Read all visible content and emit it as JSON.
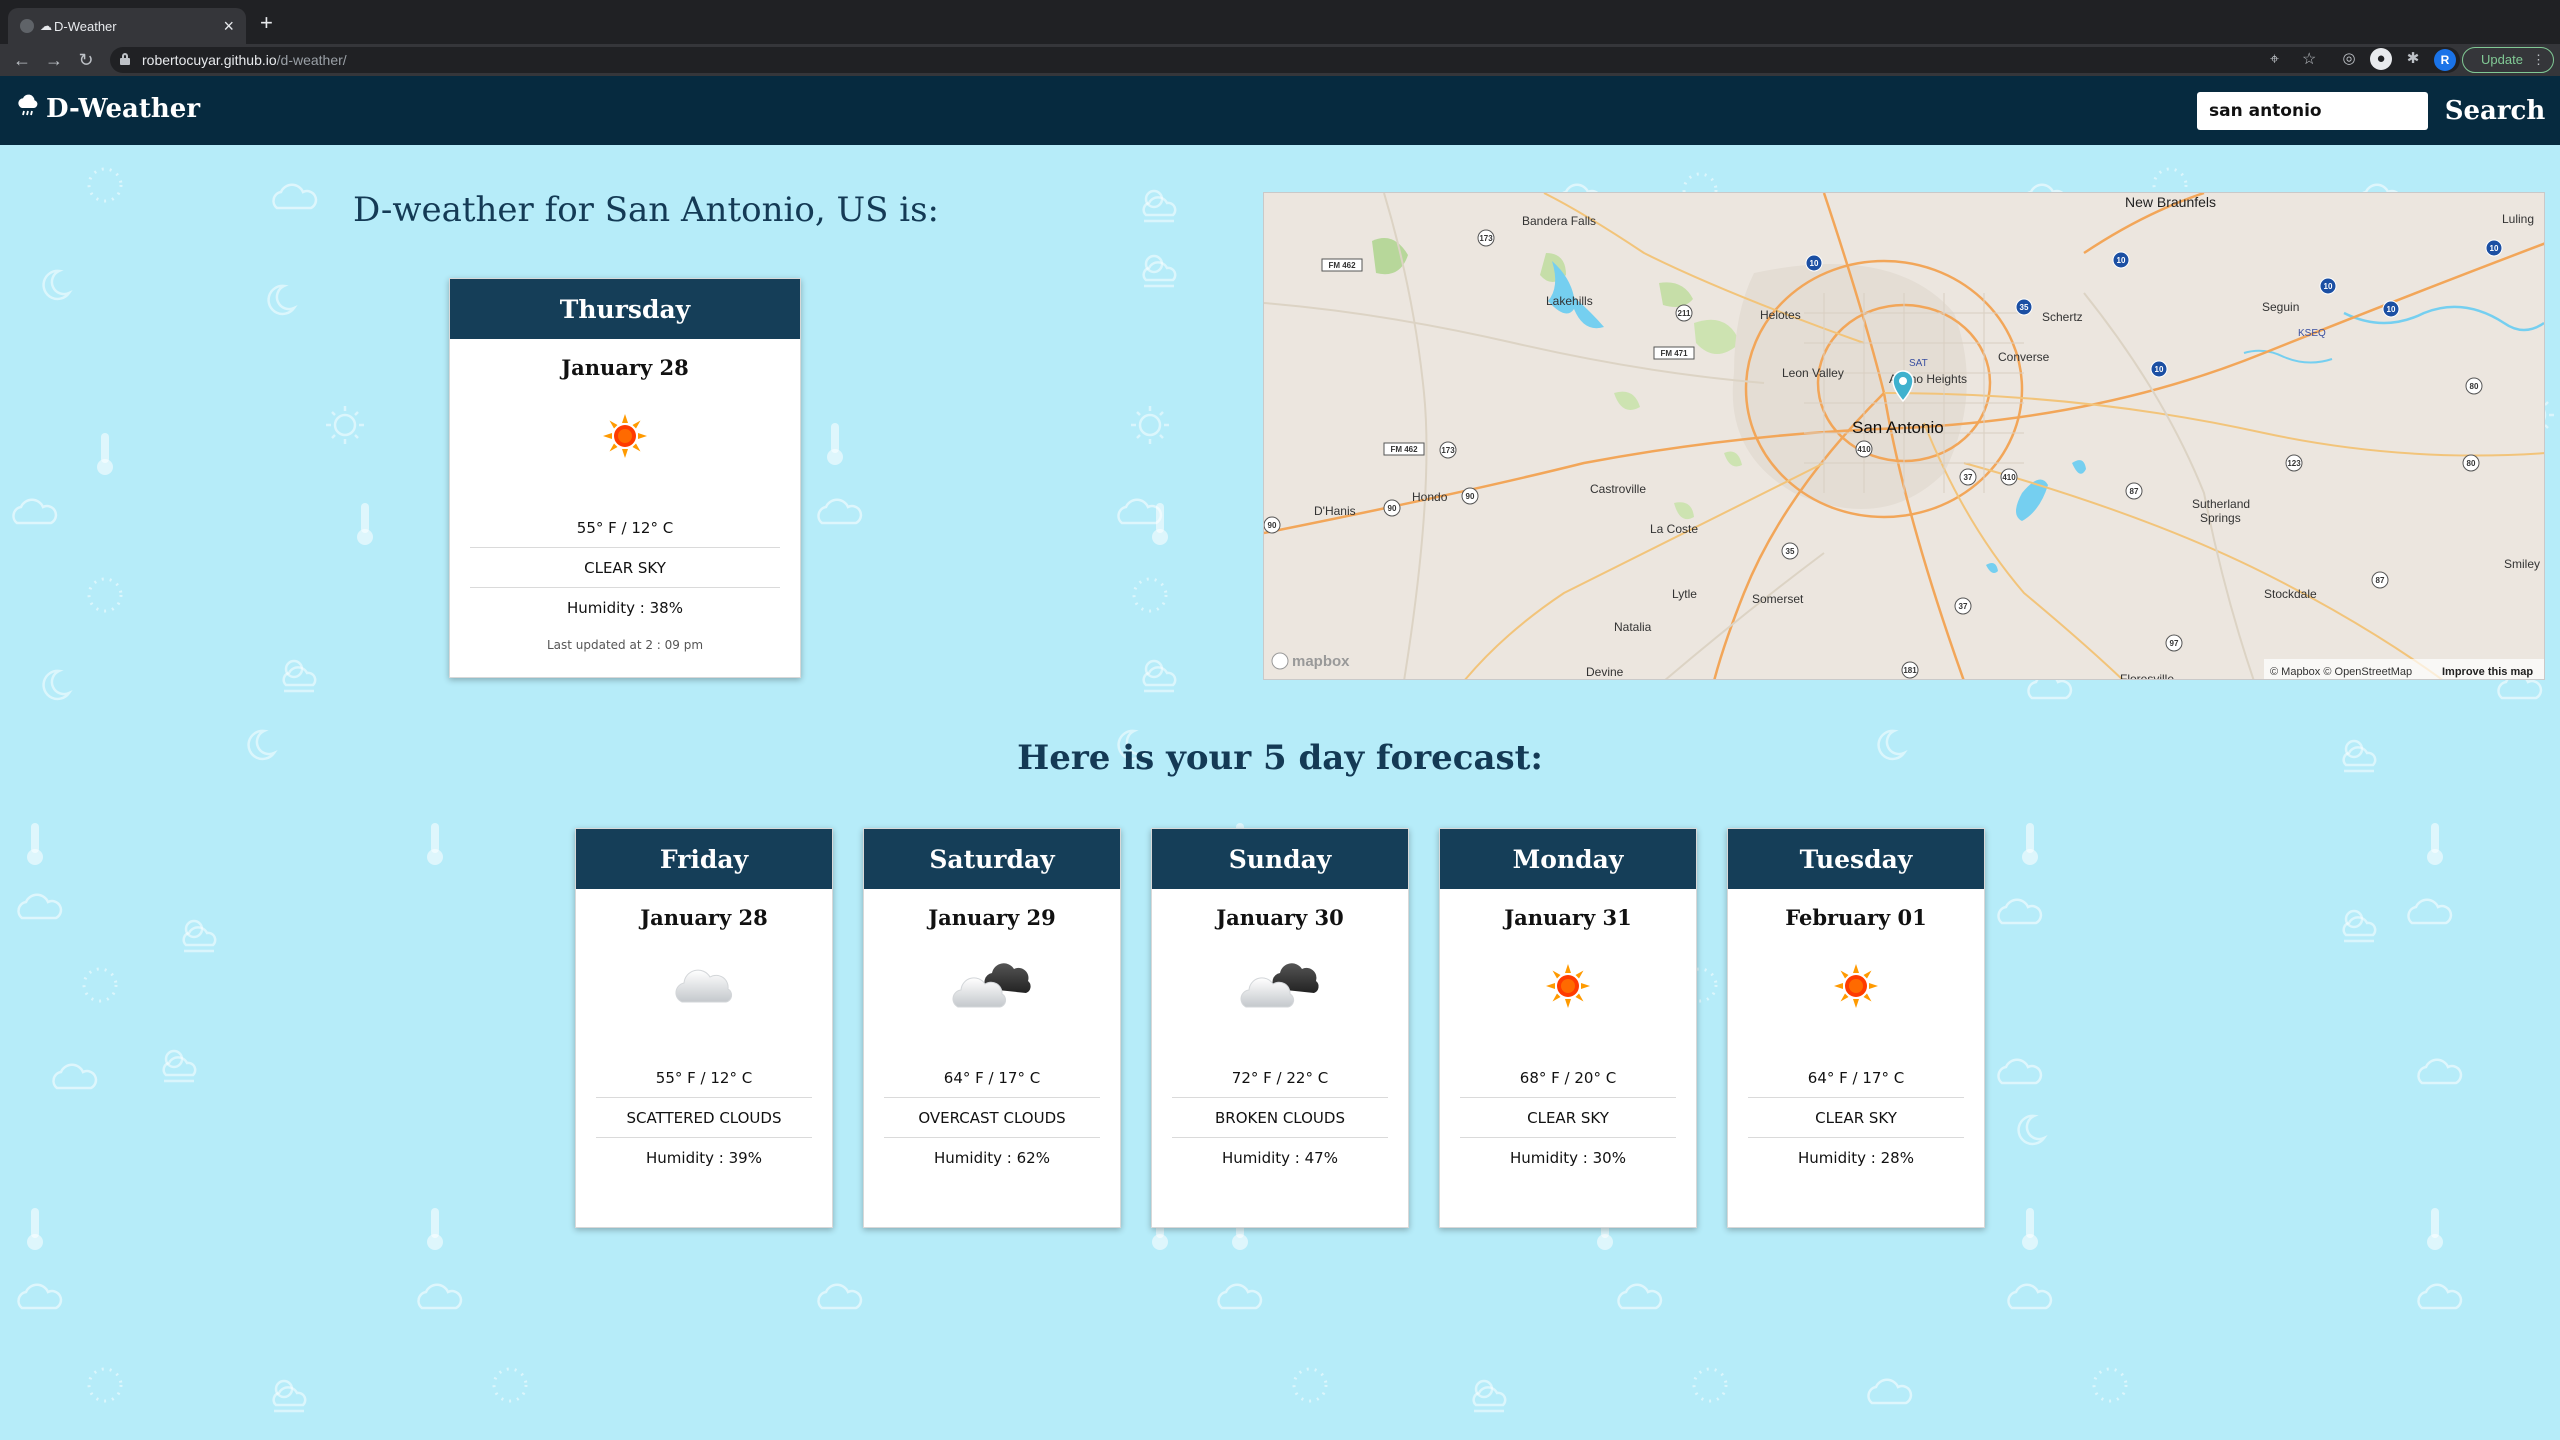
{
  "browser": {
    "tab_title": "D-Weather",
    "tab_close": "×",
    "new_tab": "+",
    "url_host": "robertocuyar.github.io",
    "url_path": "/d-weather/",
    "update_label": "Update",
    "profile_initial": "R"
  },
  "navbar": {
    "brand": "D-Weather",
    "brand_icon": "cloud-rain-icon",
    "search_value": "san antonio",
    "search_button": "Search"
  },
  "current": {
    "heading": "D-weather for San Antonio, US is:",
    "day": "Thursday",
    "date": "January 28",
    "icon": "sun-icon",
    "temp": "55° F / 12° C",
    "condition": "CLEAR SKY",
    "humidity": "Humidity : 38%",
    "updated": "Last updated at 2 : 09 pm"
  },
  "map": {
    "city_label": "San Antonio",
    "places": [
      "New Braunfels",
      "Luling",
      "Bandera Falls",
      "Lakehills",
      "Helotes",
      "Schertz",
      "Seguin",
      "Converse",
      "Leon Valley",
      "Alamo Heights",
      "Castroville",
      "Hondo",
      "D'Hanis",
      "La Coste",
      "Lytle",
      "Somerset",
      "Natalia",
      "Devine",
      "Sutherland Springs",
      "Stockdale",
      "Smiley",
      "Floresville",
      "SAT",
      "KSEQ"
    ],
    "road_shields": [
      "FM 462",
      "173",
      "211",
      "FM 471",
      "FM 462",
      "173",
      "90",
      "90",
      "90",
      "10",
      "10",
      "10",
      "35",
      "35",
      "410",
      "410",
      "37",
      "37",
      "87",
      "87",
      "123",
      "80",
      "80",
      "97",
      "181",
      "173"
    ],
    "logo": "mapbox",
    "attribution": "© Mapbox © OpenStreetMap",
    "improve": "Improve this map"
  },
  "forecast": {
    "heading": "Here is your 5 day forecast:",
    "days": [
      {
        "day": "Friday",
        "date": "January 28",
        "icon": "cloud-icon",
        "temp": "55° F / 12° C",
        "condition": "SCATTERED CLOUDS",
        "humidity": "Humidity : 39%"
      },
      {
        "day": "Saturday",
        "date": "January 29",
        "icon": "overcast-clouds-icon",
        "temp": "64° F / 17° C",
        "condition": "OVERCAST CLOUDS",
        "humidity": "Humidity : 62%"
      },
      {
        "day": "Sunday",
        "date": "January 30",
        "icon": "broken-clouds-icon",
        "temp": "72° F / 22° C",
        "condition": "BROKEN CLOUDS",
        "humidity": "Humidity : 47%"
      },
      {
        "day": "Monday",
        "date": "January 31",
        "icon": "sun-icon",
        "temp": "68° F / 20° C",
        "condition": "CLEAR SKY",
        "humidity": "Humidity : 30%"
      },
      {
        "day": "Tuesday",
        "date": "February 01",
        "icon": "sun-icon",
        "temp": "64° F / 17° C",
        "condition": "CLEAR SKY",
        "humidity": "Humidity : 28%"
      }
    ]
  },
  "colors": {
    "page_background": "#b6ecf9",
    "navbar": "#062a3f",
    "card_header": "#153e58",
    "heading_text": "#143a55",
    "map_pin": "#3fb1ce"
  }
}
